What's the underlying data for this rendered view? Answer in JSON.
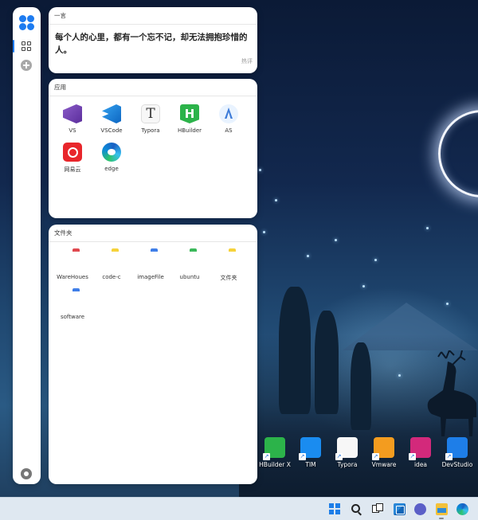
{
  "sidebar": {
    "logo_icon": "clover-logo-icon",
    "items": [
      {
        "name": "apps-grid-icon",
        "active": true
      },
      {
        "name": "add-icon",
        "active": false
      }
    ],
    "settings_icon": "settings-icon"
  },
  "quote_card": {
    "title": "一言",
    "text": "每个人的心里，都有一个忘不记，却无法拥抱珍惜的人。",
    "source": "热评"
  },
  "apps_card": {
    "title": "应用",
    "items": [
      {
        "label": "VS",
        "icon": "visual-studio-icon"
      },
      {
        "label": "VSCode",
        "icon": "vscode-icon"
      },
      {
        "label": "Typora",
        "icon": "typora-icon"
      },
      {
        "label": "HBuilder",
        "icon": "hbuilder-icon"
      },
      {
        "label": "AS",
        "icon": "android-studio-icon"
      },
      {
        "label": "网易云",
        "icon": "netease-music-icon"
      },
      {
        "label": "edge",
        "icon": "edge-icon"
      }
    ]
  },
  "folders_card": {
    "title": "文件夹",
    "items": [
      {
        "label": "WareHoues",
        "color": "#e0484f"
      },
      {
        "label": "code-c",
        "color": "#f6d23a"
      },
      {
        "label": "imageFile",
        "color": "#3f7ee8"
      },
      {
        "label": "ubuntu",
        "color": "#3bb85a"
      },
      {
        "label": "文件夹",
        "color": "#f6d23a"
      },
      {
        "label": "software",
        "color": "#3f7ee8"
      }
    ]
  },
  "desktop_shortcuts": [
    {
      "label": "HBuilder X",
      "icon": "hbuilderx-icon",
      "color": "#2cb34a"
    },
    {
      "label": "TIM",
      "icon": "tim-icon",
      "color": "#1a8cf0"
    },
    {
      "label": "Typora",
      "icon": "typora-icon",
      "color": "#f7f7f7"
    },
    {
      "label": "Vmware",
      "icon": "vmware-icon",
      "color": "#f39c1f"
    },
    {
      "label": "idea",
      "icon": "intellij-idea-icon",
      "color": "#d3297b"
    },
    {
      "label": "DevStudio",
      "icon": "devstudio-icon",
      "color": "#1e7ee8"
    }
  ],
  "taskbar": {
    "items": [
      "windows-start-icon",
      "search-icon",
      "task-view-icon",
      "widgets-icon",
      "chat-icon",
      "file-explorer-icon",
      "edge-icon"
    ]
  }
}
